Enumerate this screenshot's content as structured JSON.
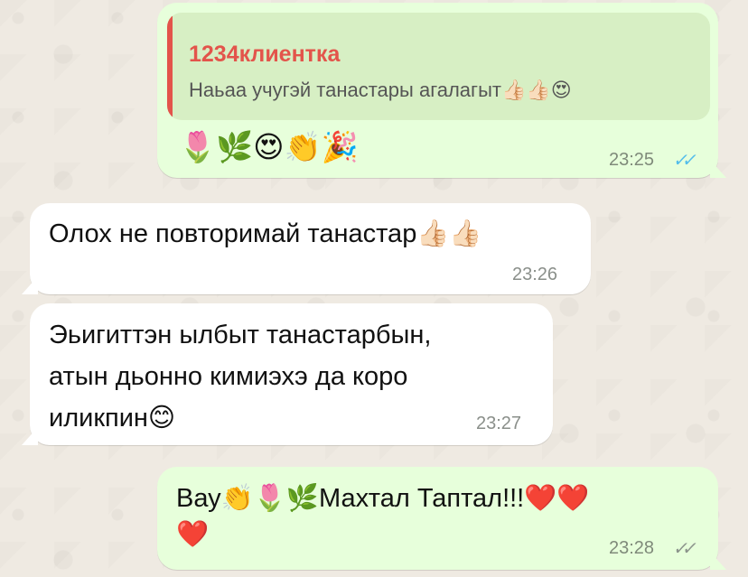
{
  "messages": [
    {
      "direction": "outgoing",
      "quoted": {
        "author": "1234клиентка",
        "text": "Наьаа учугэй танастары агалагыт👍🏻👍🏻😍"
      },
      "text": "🌷🌿😍👏🎉",
      "time": "23:25",
      "status_icon": "double-check-read"
    },
    {
      "direction": "incoming",
      "text": "Олох не повторимай танастар👍🏻👍🏻",
      "time": "23:26"
    },
    {
      "direction": "incoming",
      "text_lines": [
        "Эьигиттэн ылбыт танастарбын,",
        "атын дьонно кимиэхэ да коро",
        "иликпин😊"
      ],
      "time": "23:27"
    },
    {
      "direction": "outgoing",
      "text_lines": [
        "Вау👏🌷🌿Махтал Таптал!!!❤️❤️",
        "❤️"
      ],
      "time": "23:28",
      "status_icon": "double-check-delivered"
    }
  ],
  "colors": {
    "outgoing_bubble": "#e7ffdb",
    "incoming_bubble": "#ffffff",
    "reply_accent": "#e3544b",
    "read_checks": "#53bdeb"
  }
}
